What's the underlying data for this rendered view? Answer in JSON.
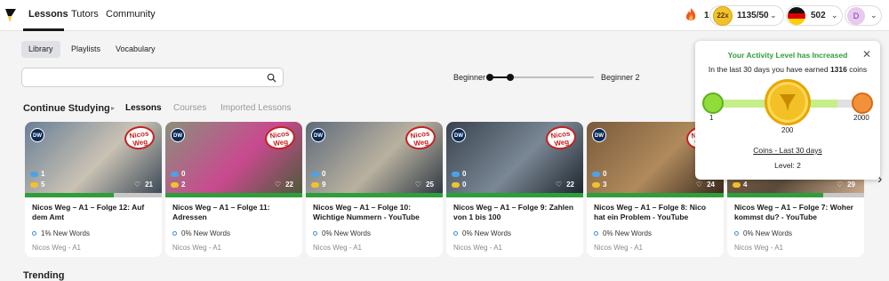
{
  "nav": {
    "lessons": "Lessons",
    "tutors": "Tutors",
    "community": "Community"
  },
  "header": {
    "streak": "1",
    "coin_multiplier": "22x",
    "coins": "1135/50",
    "language_known_words": "502",
    "avatar_initial": "D"
  },
  "subtabs": [
    "Library",
    "Playlists",
    "Vocabulary"
  ],
  "search": {
    "placeholder": ""
  },
  "level_range": {
    "from": "Beginner 1",
    "to": "Beginner 2"
  },
  "continue": {
    "title": "Continue Studying",
    "tabs": [
      "Lessons",
      "Courses",
      "Imported Lessons"
    ]
  },
  "cards": [
    {
      "title": "Nicos Weg – A1 – Folge 12: Auf dem Amt",
      "new_words": "1% New Words",
      "source": "Nicos Weg - A1",
      "blue": "1",
      "yellow": "5",
      "likes": "21",
      "progress": 0.65
    },
    {
      "title": "Nicos Weg – A1 – Folge 11: Adressen",
      "new_words": "0% New Words",
      "source": "Nicos Weg - A1",
      "blue": "0",
      "yellow": "2",
      "likes": "22",
      "progress": 1.0
    },
    {
      "title": "Nicos Weg – A1 – Folge 10: Wichtige Nummern - YouTube",
      "new_words": "0% New Words",
      "source": "Nicos Weg - A1",
      "blue": "0",
      "yellow": "9",
      "likes": "25",
      "progress": 1.0
    },
    {
      "title": "Nicos Weg – A1 – Folge 9: Zahlen von 1 bis 100",
      "new_words": "0% New Words",
      "source": "Nicos Weg - A1",
      "blue": "0",
      "yellow": "0",
      "likes": "22",
      "progress": 1.0
    },
    {
      "title": "Nicos Weg – A1 – Folge 8: Nico hat ein Problem - YouTube",
      "new_words": "0% New Words",
      "source": "Nicos Weg - A1",
      "blue": "0",
      "yellow": "3",
      "likes": "24",
      "progress": 1.0
    },
    {
      "title": "Nicos Weg – A1 – Folge 7: Woher kommst du? - YouTube",
      "new_words": "0% New Words",
      "source": "Nicos Weg - A1",
      "blue": "0",
      "yellow": "4",
      "likes": "29",
      "progress": 0.7
    }
  ],
  "trending": {
    "title": "Trending"
  },
  "popup": {
    "title": "Your Activity Level has Increased",
    "sub_prefix": "In the last 30 days you have earned ",
    "sub_coins": "1316",
    "sub_suffix": " coins",
    "scale_min": "1",
    "scale_mid": "200",
    "scale_max": "2000",
    "link": "Coins - Last 30 days",
    "level": "Level: 2"
  },
  "colors": {
    "green": "#2e9e3a",
    "accent_gold": "#f3c025",
    "blue_chip": "#4aa3e8",
    "yellow_chip": "#f2c12e"
  }
}
